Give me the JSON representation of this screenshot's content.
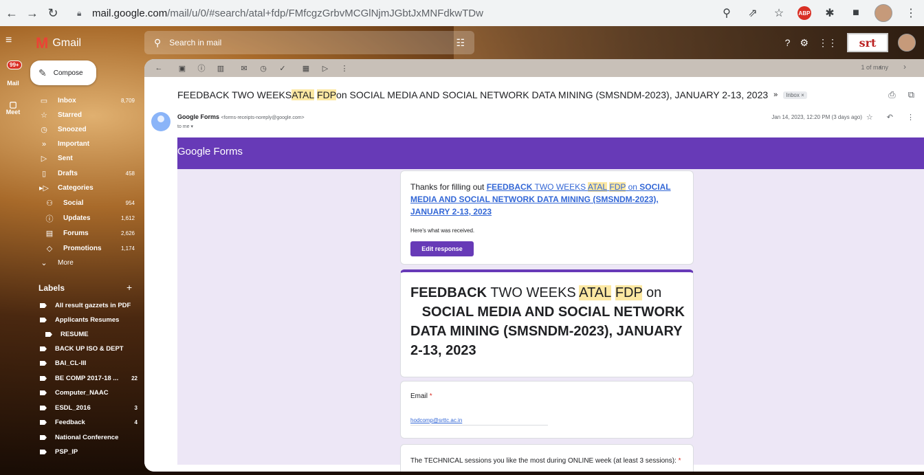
{
  "browser": {
    "url_host": "mail.google.com",
    "url_path": "/mail/u/0/#search/atal+fdp/FMfcgzGrbvMCGlNjmJGbtJxMNFdkwTDw"
  },
  "rail": {
    "mail_label": "Mail",
    "meet_label": "Meet",
    "mail_badge": "99+"
  },
  "gmail": {
    "logo_text": "Gmail",
    "search_placeholder": "Search in mail",
    "compose_label": "Compose"
  },
  "sidebar": {
    "items": [
      {
        "label": "Inbox",
        "count": "8,709",
        "icon": "inbox-icon"
      },
      {
        "label": "Starred",
        "count": "",
        "icon": "star-icon"
      },
      {
        "label": "Snoozed",
        "count": "",
        "icon": "clock-icon"
      },
      {
        "label": "Important",
        "count": "",
        "icon": "important-icon"
      },
      {
        "label": "Sent",
        "count": "",
        "icon": "send-icon"
      },
      {
        "label": "Drafts",
        "count": "458",
        "icon": "draft-icon"
      },
      {
        "label": "Categories",
        "count": "",
        "icon": "label-icon"
      },
      {
        "label": "Social",
        "count": "954",
        "icon": "people-icon"
      },
      {
        "label": "Updates",
        "count": "1,612",
        "icon": "info-icon"
      },
      {
        "label": "Forums",
        "count": "2,626",
        "icon": "forum-icon"
      },
      {
        "label": "Promotions",
        "count": "1,174",
        "icon": "tag-icon"
      },
      {
        "label": "More",
        "count": "",
        "icon": "chevron-down-icon"
      }
    ],
    "labels_header": "Labels",
    "labels": [
      {
        "label": "All result gazzets in PDF",
        "count": ""
      },
      {
        "label": "Applicants Resumes",
        "count": ""
      },
      {
        "label": "RESUME",
        "count": ""
      },
      {
        "label": "BACK UP ISO & DEPT",
        "count": ""
      },
      {
        "label": "BAI_CL-III",
        "count": ""
      },
      {
        "label": "BE COMP 2017-18 ...",
        "count": "22"
      },
      {
        "label": "Computer_NAAC",
        "count": ""
      },
      {
        "label": "ESDL_2016",
        "count": "3"
      },
      {
        "label": "Feedback",
        "count": "4"
      },
      {
        "label": "National Conference",
        "count": ""
      },
      {
        "label": "PSP_IP",
        "count": ""
      }
    ]
  },
  "toolbar": {
    "pager": "1 of many"
  },
  "email": {
    "subject_pre": "FEEDBACK TWO WEEKS ",
    "subject_hl1": "ATAL",
    "subject_hl2": "FDP",
    "subject_post": " on SOCIAL MEDIA AND SOCIAL NETWORK DATA MINING (SMSNDM-2023), JANUARY 2-13, 2023",
    "inbox_tag": "Inbox ×",
    "sender_name": "Google Forms",
    "sender_email": "<forms-receipts-noreply@google.com>",
    "to": "to me ▾",
    "date": "Jan 14, 2023, 12:20 PM (3 days ago)"
  },
  "form": {
    "header_logo": "Google Forms",
    "thanks_pre": "Thanks for filling out ",
    "link_a": "FEEDBACK",
    "link_b": " TWO WEEKS ",
    "link_hl1": "ATAL",
    "link_hl2": "FDP",
    "link_c": " on ",
    "link_d": "SOCIAL MEDIA AND SOCIAL NETWORK DATA MINING (SMSNDM-2023), JANUARY 2-13, 2023",
    "received": "Here's what was received.",
    "edit_button": "Edit response",
    "title_a": "FEEDBACK",
    "title_b": " TWO WEEKS ",
    "title_hl1": "ATAL",
    "title_hl2": "FDP",
    "title_c": " on",
    "title_d": "SOCIAL MEDIA AND SOCIAL NETWORK DATA MINING (SMSNDM-2023), JANUARY 2-13, 2023",
    "q_email": "Email",
    "a_email": "hodcomp@srttc.ac.in",
    "q_technical": "The TECHNICAL sessions you like the most during ONLINE week (at least 3 sessions):",
    "required_mark": "*"
  },
  "colors": {
    "forms_purple": "#673ab7",
    "highlight": "#fce8a2",
    "link": "#3367d6"
  }
}
